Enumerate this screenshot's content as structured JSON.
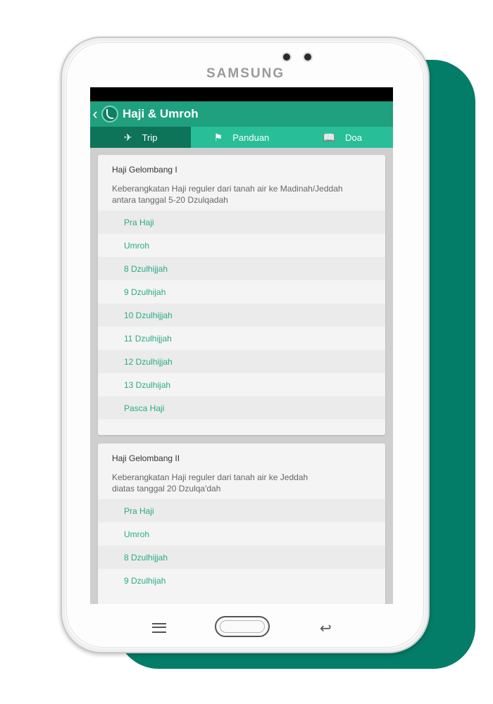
{
  "device": {
    "brand": "SAMSUNG"
  },
  "app": {
    "title": "Haji & Umroh",
    "back_icon": "chevron-left-icon",
    "logo_icon": "app-logo-icon",
    "colors": {
      "appbar": "#1fa07f",
      "tabs": "#28bf98",
      "active_tab": "#0d7359",
      "link": "#2aaa86",
      "backdrop": "#037d67"
    }
  },
  "tabs": [
    {
      "label": "Trip",
      "icon": "airplane-icon",
      "glyph": "✈",
      "active": true
    },
    {
      "label": "Panduan",
      "icon": "signpost-icon",
      "glyph": "⚑",
      "active": false
    },
    {
      "label": "Doa",
      "icon": "book-icon",
      "glyph": "📖",
      "active": false
    }
  ],
  "cards": [
    {
      "title": "Haji Gelombang I",
      "description": "Keberangkatan Haji reguler dari tanah air ke Madinah/Jeddah\nantara tanggal  5-20 Dzulqadah",
      "items": [
        "Pra Haji",
        "Umroh",
        "8 Dzulhijjah",
        "9 Dzulhijah",
        "10 Dzulhijjah",
        "11 Dzulhijjah",
        "12 Dzulhijjah",
        "13 Dzulhijah",
        "Pasca Haji"
      ]
    },
    {
      "title": "Haji Gelombang II",
      "description": "Keberangkatan Haji reguler dari tanah air ke Jeddah\ndiatas tanggal  20 Dzulqa'dah",
      "items": [
        "Pra Haji",
        "Umroh",
        "8 Dzulhijjah",
        "9 Dzulhijah"
      ]
    }
  ],
  "navbar": {
    "menu_icon": "menu-icon",
    "home_icon": "home-button-icon",
    "back_icon": "back-arrow-icon"
  }
}
